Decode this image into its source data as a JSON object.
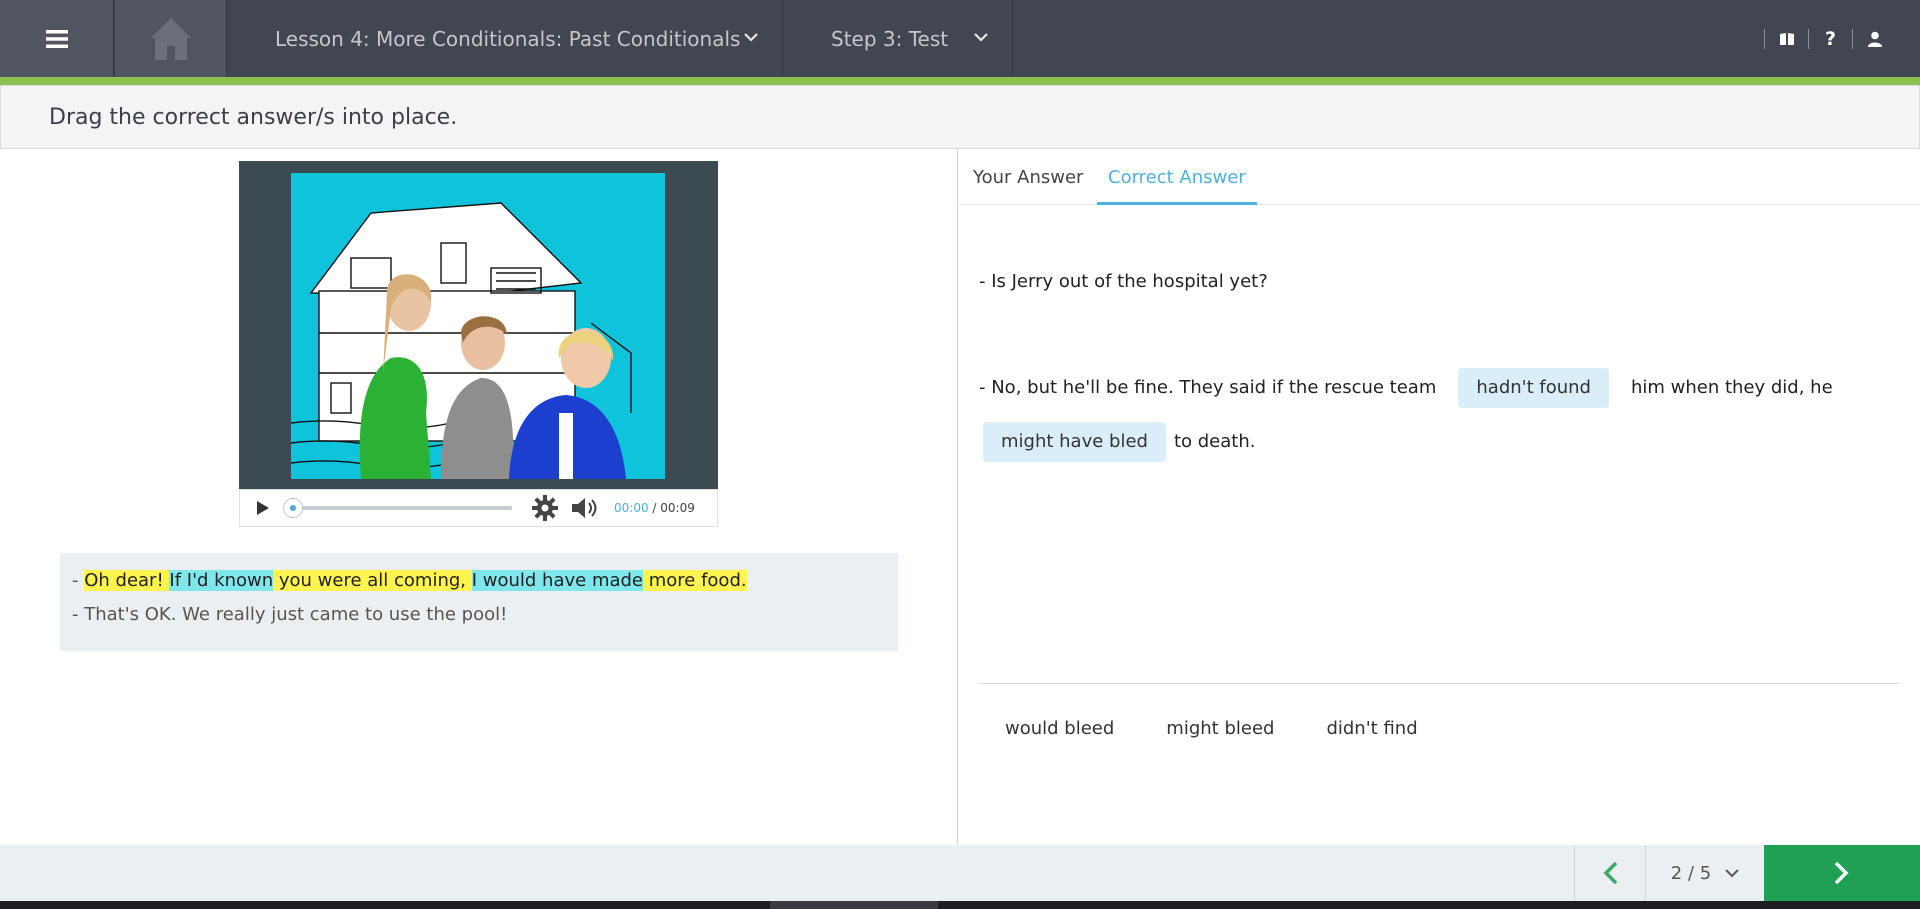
{
  "header": {
    "lesson_label": "Lesson 4: More Conditionals: Past Conditionals",
    "step_label": "Step 3: Test",
    "icons": [
      "menu-icon",
      "home-icon",
      "book-icon",
      "help-icon",
      "user-icon"
    ],
    "help_glyph": "?"
  },
  "instruction": "Drag the correct answer/s into place.",
  "video": {
    "current_time": "00:00",
    "separator": " / ",
    "duration": "00:09",
    "progress": 0
  },
  "transcript": {
    "line1": {
      "dash": "- ",
      "p1": "Oh dear! ",
      "p2": "If I'd known",
      "p3": " you were all coming, ",
      "p4": "I would have made",
      "p5": " more food."
    },
    "line2": "- That's OK. We really just came to use the pool!"
  },
  "tabs": {
    "your_answer": "Your Answer",
    "correct_answer": "Correct Answer",
    "active": "correct_answer"
  },
  "question": {
    "line1": "- Is Jerry out of the hospital yet?",
    "line2_before": "- No, but he'll be fine. They said if the rescue team",
    "blank1": "hadn't found",
    "line2_middle": "him when they did, he",
    "blank2": "might have bled",
    "line2_after": "to death."
  },
  "word_bank": [
    "would bleed",
    "might bleed",
    "didn't find"
  ],
  "footer": {
    "page": "2 / 5"
  },
  "colors": {
    "topbar": "#424650",
    "accent_green": "#8cc152",
    "next_button": "#1ea155",
    "tab_active": "#4fb0db",
    "chip": "#d9eef9",
    "highlight_yellow": "#fff44f",
    "highlight_cyan": "#7fe6ec"
  }
}
